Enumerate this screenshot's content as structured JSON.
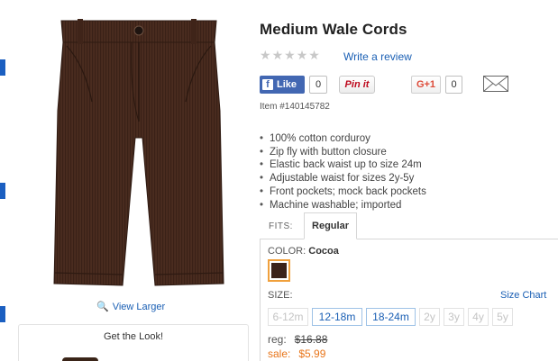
{
  "product": {
    "title": "Medium Wale Cords",
    "item_number": "Item #140145782",
    "features": [
      "100% cotton corduroy",
      "Zip fly with button closure",
      "Elastic back waist up to size 24m",
      "Adjustable waist for sizes 2y-5y",
      "Front pockets; mock back pockets",
      "Machine washable; imported"
    ],
    "image_icon": "corduroy-pants-image"
  },
  "reviews": {
    "rating_stars": 0,
    "write_review_label": "Write a review"
  },
  "social": {
    "fb_like_label": "Like",
    "fb_like_count": "0",
    "pinit_label": "Pin it",
    "gplus_label": "G+1",
    "gplus_count": "0",
    "email_icon": "envelope-icon"
  },
  "gallery": {
    "view_larger_label": "View Larger",
    "get_the_look_label": "Get the Look!"
  },
  "fits": {
    "label": "FITS:",
    "selected_tab": "Regular"
  },
  "color": {
    "label": "COLOR:",
    "selected": "Cocoa",
    "swatch_hex": "#3b2219"
  },
  "size": {
    "label": "SIZE:",
    "chart_link": "Size Chart",
    "options": [
      {
        "label": "6-12m",
        "available": false
      },
      {
        "label": "12-18m",
        "available": true
      },
      {
        "label": "18-24m",
        "available": true
      },
      {
        "label": "2y",
        "available": false
      },
      {
        "label": "3y",
        "available": false
      },
      {
        "label": "4y",
        "available": false
      },
      {
        "label": "5y",
        "available": false
      }
    ]
  },
  "price": {
    "reg_label": "reg:",
    "reg_value": "$16.88",
    "sale_label": "sale:",
    "sale_value": "$5.99"
  },
  "colors": {
    "link": "#1a5fb4",
    "sale": "#e8751a",
    "facebook": "#4267b2",
    "pinterest": "#bd081c",
    "selected_border": "#f0a03c"
  }
}
